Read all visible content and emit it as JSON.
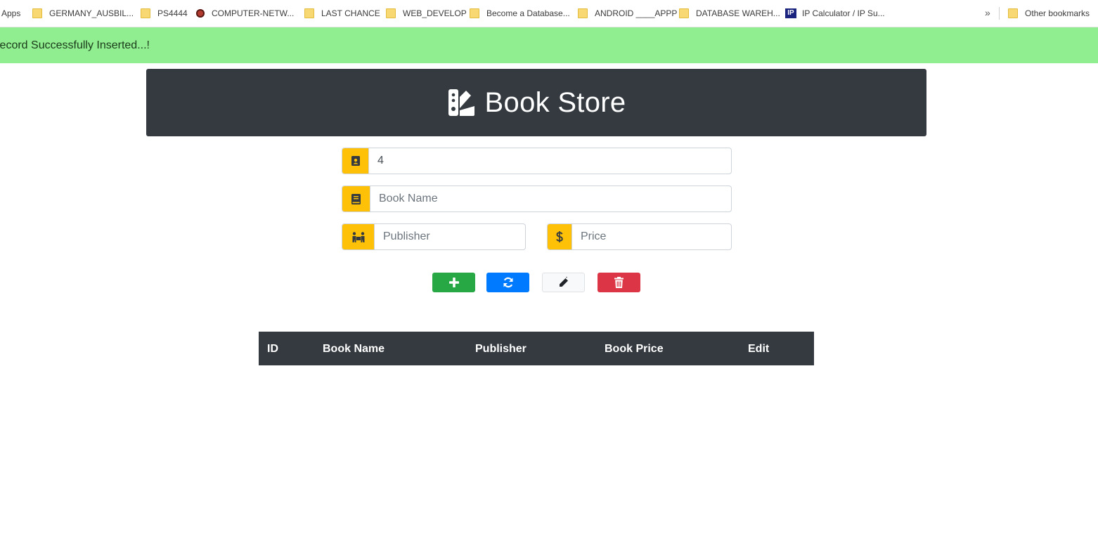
{
  "bookmarks": {
    "items": [
      {
        "label": "Apps",
        "icon": "apps-grid-icon"
      },
      {
        "label": "GERMANY_AUSBIL...",
        "icon": "folder-icon"
      },
      {
        "label": "PS4444",
        "icon": "folder-icon"
      },
      {
        "label": "COMPUTER-NETW...",
        "icon": "site-favicon"
      },
      {
        "label": "LAST CHANCE",
        "icon": "folder-icon"
      },
      {
        "label": "WEB_DEVELOP",
        "icon": "folder-icon"
      },
      {
        "label": "Become a Database...",
        "icon": "folder-icon"
      },
      {
        "label": "ANDROID ____APPP",
        "icon": "folder-icon"
      },
      {
        "label": "DATABASE WAREH...",
        "icon": "folder-icon"
      },
      {
        "label": "IP Calculator / IP Su...",
        "icon": "ip-favicon"
      }
    ],
    "overflow": "»",
    "other": "Other bookmarks",
    "ip_badge": "IP"
  },
  "alert": {
    "message": "Record Successfully Inserted...!",
    "color": "#90ee90"
  },
  "header": {
    "title": "Book Store",
    "background": "#343a40"
  },
  "form": {
    "id": {
      "value": "4",
      "icon": "id-badge-icon"
    },
    "book_name": {
      "value": "",
      "placeholder": "Book Name",
      "icon": "book-icon"
    },
    "publisher": {
      "value": "",
      "placeholder": "Publisher",
      "icon": "people-carry-icon"
    },
    "price": {
      "value": "",
      "placeholder": "Price",
      "icon": "dollar-icon"
    },
    "addon_color": "#ffc107"
  },
  "buttons": {
    "add": {
      "icon": "plus-icon",
      "color": "#28a745"
    },
    "refresh": {
      "icon": "sync-icon",
      "color": "#007bff"
    },
    "edit": {
      "icon": "pencil-icon",
      "color": "#f8f9fa"
    },
    "delete": {
      "icon": "trash-icon",
      "color": "#dc3545"
    }
  },
  "table": {
    "columns": [
      "ID",
      "Book Name",
      "Publisher",
      "Book Price",
      "Edit"
    ],
    "rows": []
  }
}
